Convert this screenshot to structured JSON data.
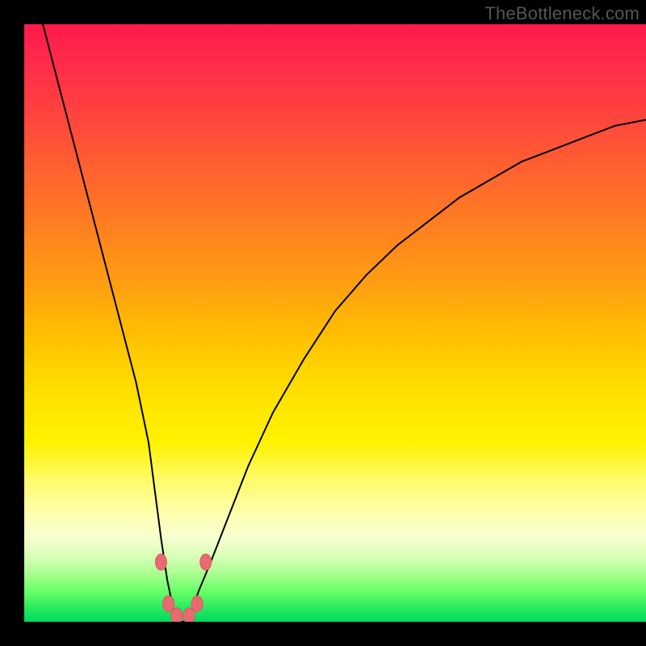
{
  "attribution": "TheBottleneck.com",
  "colors": {
    "frame": "#000000",
    "gradient_top": "#ff1a4d",
    "gradient_bottom": "#00d860",
    "curve": "#000000",
    "marker": "#e86a6f"
  },
  "chart_data": {
    "type": "line",
    "title": "",
    "xlabel": "",
    "ylabel": "",
    "xlim": [
      0,
      100
    ],
    "ylim": [
      0,
      100
    ],
    "grid": false,
    "legend": false,
    "series": [
      {
        "name": "bottleneck-curve",
        "x": [
          3,
          5,
          8,
          10,
          12,
          14,
          16,
          18,
          20,
          21,
          22,
          23,
          24,
          25,
          26,
          27,
          28,
          30,
          33,
          36,
          40,
          45,
          50,
          55,
          60,
          65,
          70,
          75,
          80,
          85,
          90,
          95,
          100
        ],
        "y": [
          100,
          92,
          80,
          72,
          64,
          56,
          48,
          40,
          30,
          22,
          14,
          7,
          2,
          0,
          0,
          2,
          5,
          10,
          18,
          26,
          35,
          44,
          52,
          58,
          63,
          67,
          71,
          74,
          77,
          79,
          81,
          83,
          84
        ]
      }
    ],
    "markers": [
      {
        "x": 22.0,
        "y": 10
      },
      {
        "x": 23.2,
        "y": 3
      },
      {
        "x": 24.5,
        "y": 1
      },
      {
        "x": 26.5,
        "y": 1
      },
      {
        "x": 27.8,
        "y": 3
      },
      {
        "x": 29.2,
        "y": 10
      }
    ],
    "background_gradient": {
      "orientation": "vertical",
      "stops": [
        {
          "pos": 0,
          "color": "#ff1a4d"
        },
        {
          "pos": 50,
          "color": "#ffbf00"
        },
        {
          "pos": 80,
          "color": "#ffffb0"
        },
        {
          "pos": 100,
          "color": "#00d860"
        }
      ]
    }
  }
}
